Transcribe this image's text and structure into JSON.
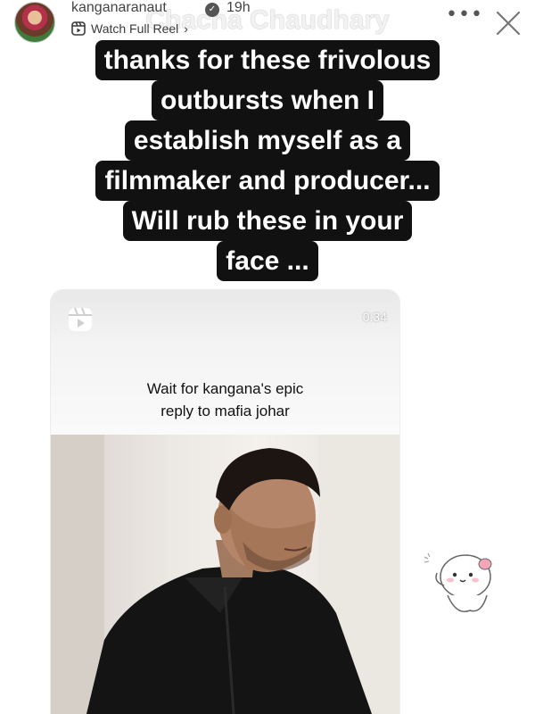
{
  "header": {
    "username": "kanganaranaut",
    "timestamp": "19h",
    "reel_link": "Watch Full Reel"
  },
  "caption": {
    "lines": [
      "Chacha Chaudhary",
      "thanks for these frivolous",
      "outbursts when I",
      "establish myself as a",
      "filmmaker and producer...",
      "Will rub these in your",
      "face ..."
    ]
  },
  "reel": {
    "duration": "0:34",
    "overlay_line1": "Wait for kangana's epic",
    "overlay_line2": "reply to mafia johar"
  },
  "colors": {
    "caption_bg": "#111111",
    "caption_text": "#ffffff"
  }
}
